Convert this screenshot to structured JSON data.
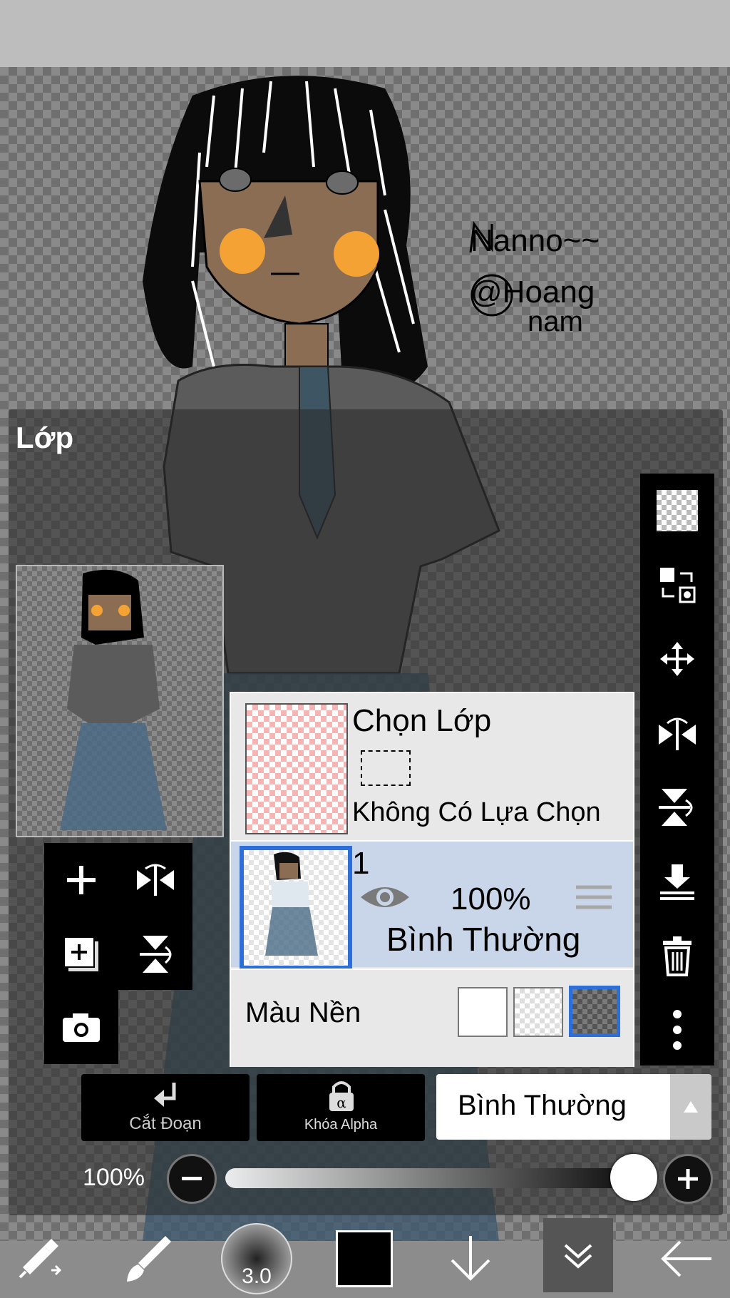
{
  "canvas": {
    "signature_lines": [
      "Nanno~~",
      "@Hoang",
      "nam"
    ]
  },
  "layer_panel": {
    "title": "Lớp",
    "selection_layer": {
      "name": "Chọn Lớp",
      "status": "Không Có Lựa Chọn"
    },
    "layers": [
      {
        "name": "1",
        "opacity": "100%",
        "blend_mode": "Bình Thường",
        "visible": true,
        "selected": true
      }
    ],
    "background": {
      "label": "Màu Nền",
      "options": [
        "white",
        "transparent-light",
        "transparent-dark"
      ],
      "selected": "transparent-dark"
    },
    "left_tools": [
      "add-layer",
      "flip-horizontal",
      "duplicate-layer",
      "flip-vertical",
      "camera"
    ],
    "right_tools": [
      "transparent-fill",
      "swap-layers",
      "move",
      "flip-h-layer",
      "flip-v-layer",
      "merge-down",
      "delete",
      "more"
    ],
    "clipping_label": "Cắt Đoạn",
    "alpha_lock_label": "Khóa Alpha",
    "blend_mode": "Bình Thường",
    "opacity_label": "100%",
    "opacity_value": 100
  },
  "bottom_toolbar": {
    "brush_size": "3.0",
    "color": "#000000",
    "items": [
      "transform-tool",
      "brush-tool",
      "brush-size",
      "color",
      "arrow-down",
      "layers",
      "back"
    ]
  },
  "colors": {
    "accent": "#2d6fd8",
    "selected_layer_bg": "#c9d6ea"
  }
}
